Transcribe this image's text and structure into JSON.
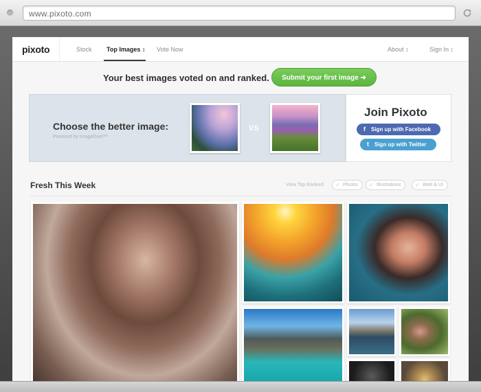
{
  "browser": {
    "url": "www.pixoto.com",
    "reload_icon": "reload-icon"
  },
  "nav": {
    "logo": "pixoto",
    "items": [
      {
        "label": "Stock"
      },
      {
        "label": "Top Images ↕"
      },
      {
        "label": "Vote Now"
      }
    ],
    "right": [
      {
        "label": "About ↕"
      },
      {
        "label": "Sign In ↕"
      }
    ]
  },
  "hero": {
    "headline": "Your best images voted on and ranked.",
    "cta": "Submit your first image ➜"
  },
  "duel": {
    "title": "Choose the better image:",
    "subtitle": "Powered by ImageDuel™",
    "vs": "VS"
  },
  "join": {
    "title": "Join Pixoto",
    "facebook": "Sign up with Facebook",
    "twitter": "Sign up with Twitter",
    "facebook_icon": "f",
    "twitter_icon": "t"
  },
  "fresh": {
    "title": "Fresh This Week",
    "view_top": "View Top Ranked:",
    "filters": [
      "Photos",
      "Illustrations",
      "Web & UI"
    ]
  },
  "colors": {
    "cta_green": "#66bf48",
    "facebook_blue": "#4d6ab0",
    "twitter_blue": "#4aa0d0",
    "duel_bg": "#dde3ea"
  }
}
